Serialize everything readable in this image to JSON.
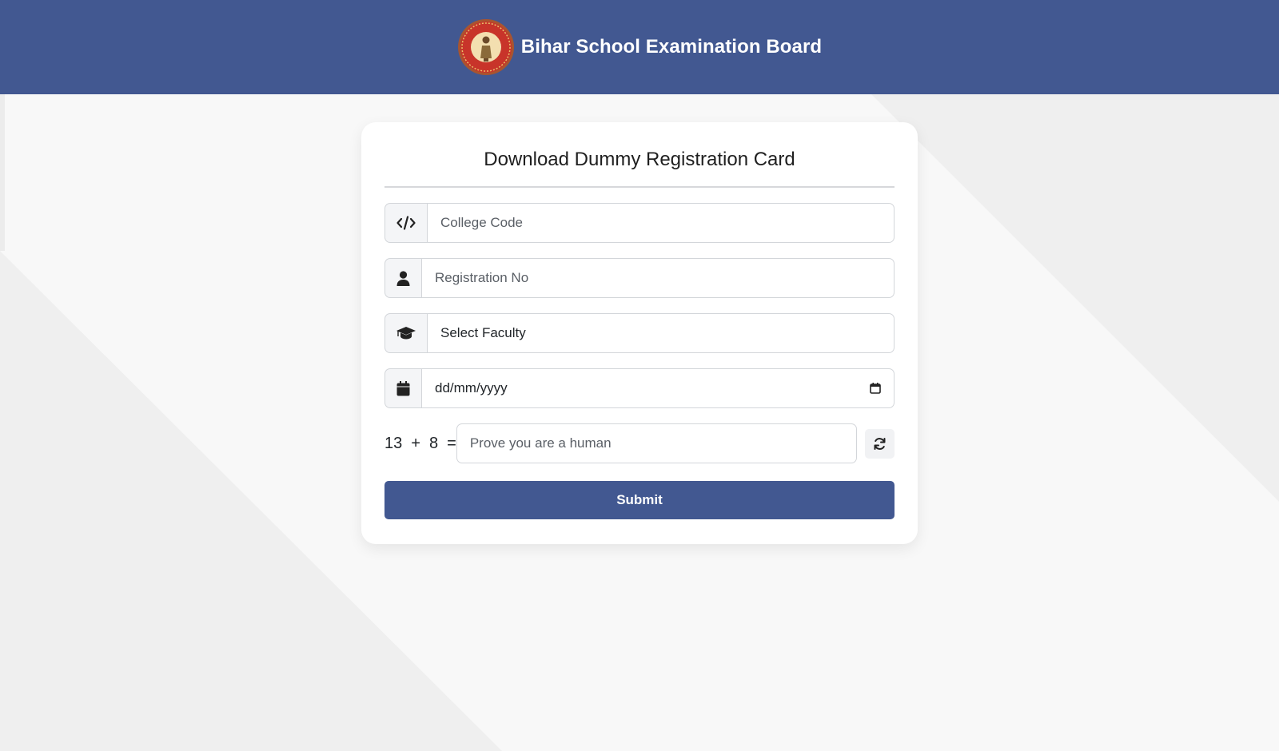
{
  "header": {
    "brand": "Bihar School Examination Board",
    "logo_icon": "bseb-seal-logo",
    "background": "#425891"
  },
  "form": {
    "title": "Download Dummy Registration Card",
    "college_code": {
      "placeholder": "College Code",
      "icon": "code-icon"
    },
    "registration_no": {
      "placeholder": "Registration No",
      "icon": "user-icon"
    },
    "faculty": {
      "value": "Select Faculty",
      "icon": "graduation-cap-icon"
    },
    "dob": {
      "value": "dd/mm/yyyy",
      "icon": "calendar-icon"
    },
    "captcha": {
      "a": "13",
      "op": "+",
      "b": "8",
      "eq": "=",
      "placeholder": "Prove you are a human",
      "refresh_icon": "refresh-icon"
    },
    "submit_label": "Submit",
    "accent": "#425891"
  }
}
